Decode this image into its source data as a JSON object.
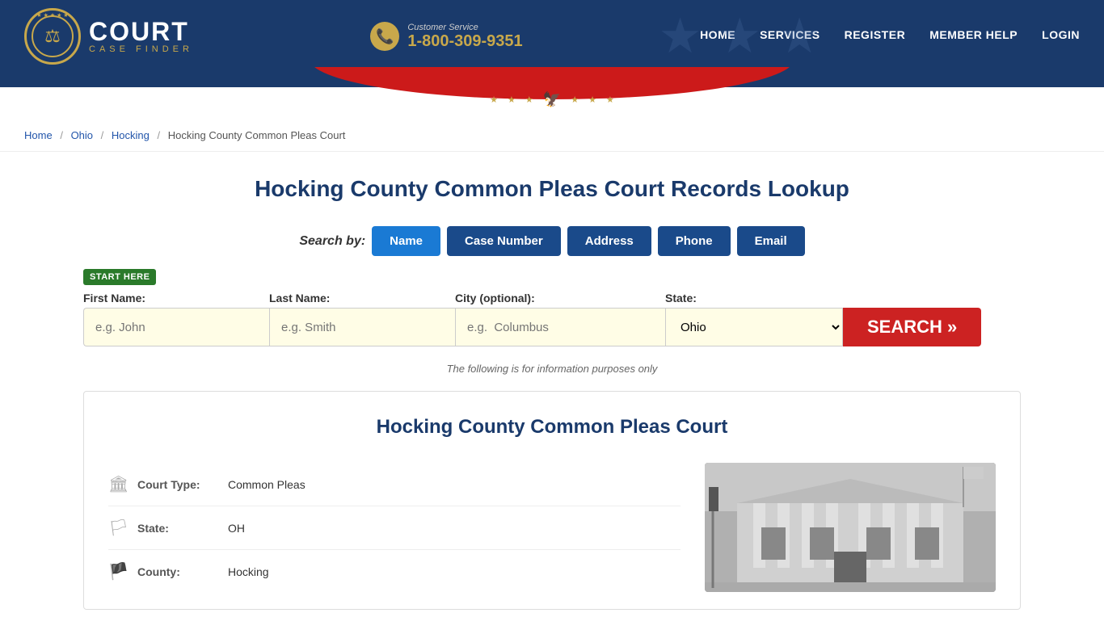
{
  "header": {
    "logo_court": "COURT",
    "logo_case_finder": "CASE FINDER",
    "customer_service_label": "Customer Service",
    "phone_number": "1-800-309-9351",
    "nav_items": [
      {
        "label": "HOME",
        "href": "#"
      },
      {
        "label": "SERVICES",
        "href": "#"
      },
      {
        "label": "REGISTER",
        "href": "#"
      },
      {
        "label": "MEMBER HELP",
        "href": "#"
      },
      {
        "label": "LOGIN",
        "href": "#"
      }
    ]
  },
  "breadcrumb": {
    "items": [
      {
        "label": "Home",
        "href": "#"
      },
      {
        "label": "Ohio",
        "href": "#"
      },
      {
        "label": "Hocking",
        "href": "#"
      },
      {
        "label": "Hocking County Common Pleas Court",
        "href": null
      }
    ]
  },
  "page": {
    "title": "Hocking County Common Pleas Court Records Lookup"
  },
  "search": {
    "by_label": "Search by:",
    "tabs": [
      {
        "label": "Name",
        "active": true
      },
      {
        "label": "Case Number",
        "active": false
      },
      {
        "label": "Address",
        "active": false
      },
      {
        "label": "Phone",
        "active": false
      },
      {
        "label": "Email",
        "active": false
      }
    ],
    "start_here_badge": "START HERE",
    "fields": {
      "first_name_label": "First Name:",
      "first_name_placeholder": "e.g. John",
      "last_name_label": "Last Name:",
      "last_name_placeholder": "e.g. Smith",
      "city_label": "City (optional):",
      "city_placeholder": "e.g.  Columbus",
      "state_label": "State:",
      "state_value": "Ohio"
    },
    "search_button_label": "SEARCH »",
    "info_note": "The following is for information purposes only"
  },
  "court_info": {
    "title": "Hocking County Common Pleas Court",
    "details": [
      {
        "icon": "🏛",
        "label": "Court Type:",
        "value": "Common Pleas"
      },
      {
        "icon": "🏳",
        "label": "State:",
        "value": "OH"
      },
      {
        "icon": "🏴",
        "label": "County:",
        "value": "Hocking"
      }
    ]
  },
  "colors": {
    "primary_blue": "#1a3a6b",
    "accent_gold": "#c8a84b",
    "active_tab_blue": "#1a7ad4",
    "search_red": "#cc2222",
    "start_green": "#2a7a2a",
    "input_bg": "#fffde6"
  }
}
